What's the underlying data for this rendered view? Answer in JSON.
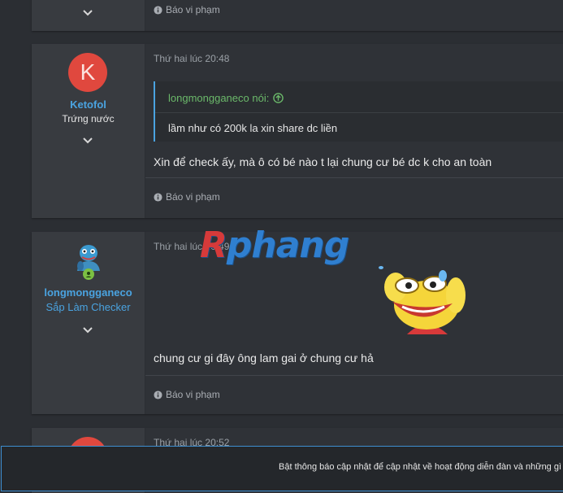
{
  "posts": [
    {
      "report_label": "Báo vi phạm"
    },
    {
      "avatar_letter": "K",
      "username": "Ketofol",
      "user_title": "Trứng nước",
      "date": "Thứ hai lúc 20:48",
      "quote": {
        "author": "longmongganeco nói:",
        "text": "lầm như có 200k la xin share dc liền"
      },
      "message": "Xin để check ấy, mà ô có bé nào t lại chung cư bé dc k cho an toàn",
      "report_label": "Báo vi phạm"
    },
    {
      "username": "longmongganeco",
      "user_title": "Sắp Làm Checker",
      "date": "Thứ hai lúc 20:49",
      "message": "chung cư gi đây ông lam gai ở chung cư hả",
      "report_label": "Báo vi phạm"
    },
    {
      "date": "Thứ hai lúc 20:52"
    }
  ],
  "watermark": {
    "first": "R",
    "rest": "phang"
  },
  "notice": {
    "text": "Bật thông báo cập nhật để cập nhật về hoạt động diễn đàn và những gì l"
  },
  "colors": {
    "accent": "#4aa3e0",
    "quote_author": "#6bb96a",
    "avatar": "#e0483e"
  }
}
